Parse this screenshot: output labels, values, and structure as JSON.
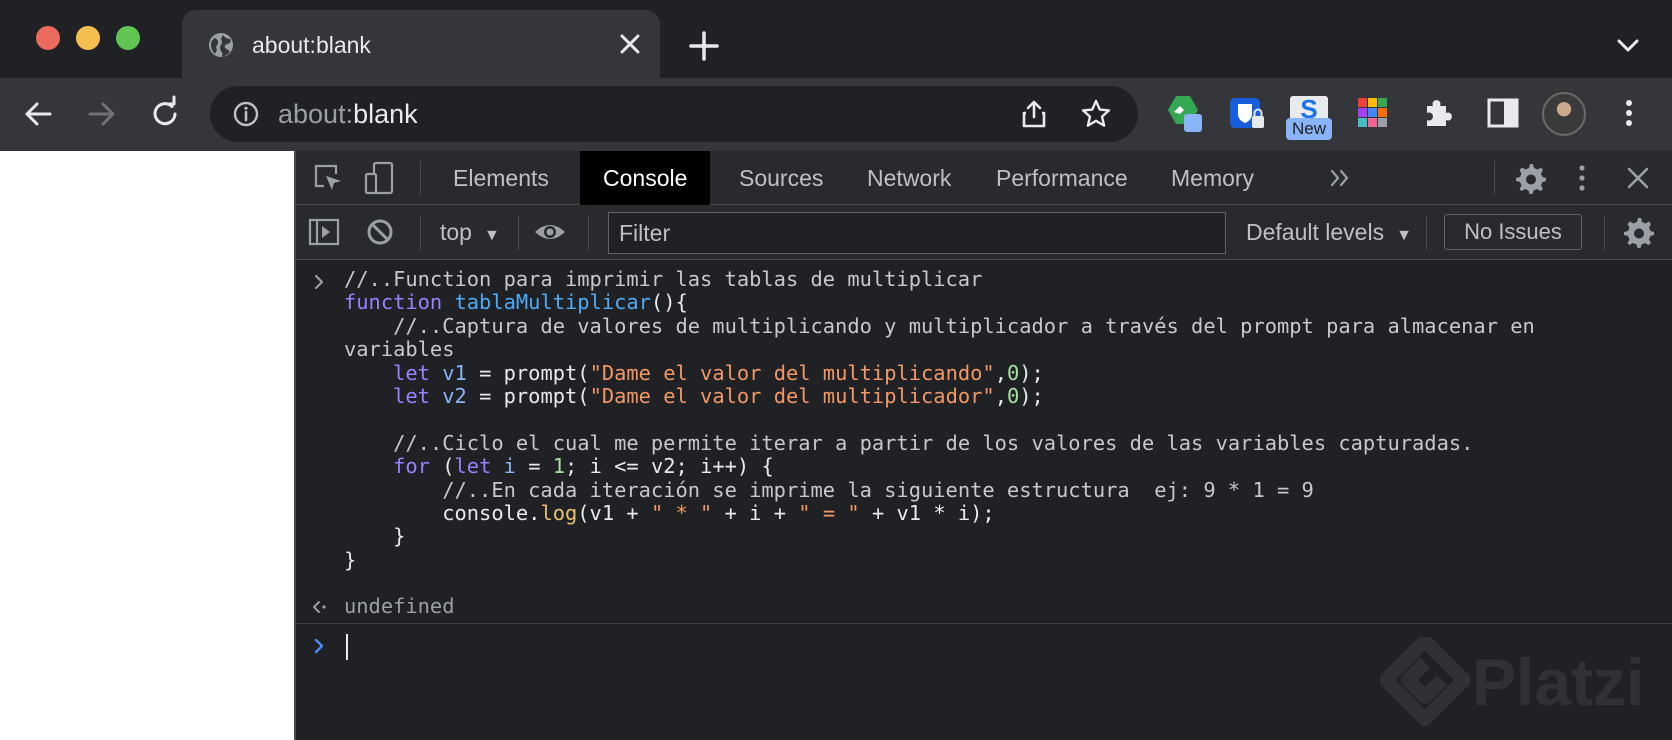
{
  "tab": {
    "title": "about:blank",
    "icon": "globe-icon"
  },
  "address_bar": {
    "scheme": "about:",
    "host": "blank"
  },
  "extensions": {
    "new_badge": "New"
  },
  "devtools": {
    "tabs": [
      "Elements",
      "Console",
      "Sources",
      "Network",
      "Performance",
      "Memory"
    ],
    "active_tab": "Console",
    "context": "top",
    "filter_placeholder": "Filter",
    "levels": "Default levels",
    "issues": "No Issues"
  },
  "console": {
    "code_lines": [
      "//..Function para imprimir las tablas de multiplicar",
      "function tablaMultiplicar(){",
      "    //..Captura de valores de multiplicando y multiplicador a través del prompt para almacenar en variables",
      "    let v1 = prompt(\"Dame el valor del multiplicando\",0);",
      "    let v2 = prompt(\"Dame el valor del multiplicador\",0);",
      "",
      "    //..Ciclo el cual me permite iterar a partir de los valores de las variables capturadas.",
      "    for (let i = 1; i <= v2; i++) {",
      "        //..En cada iteración se imprime la siguiente estructura  ej: 9 * 1 = 9",
      "        console.log(v1 + \" * \" + i + \" = \" + v1 * i);",
      "    }",
      "}"
    ],
    "result": "undefined"
  },
  "watermark": {
    "text": "Platzi"
  },
  "colors": {
    "chrome_dark": "#202124",
    "toolbar": "#35363a",
    "devtools_bar": "#292a2d",
    "active_tab_bg": "#000000",
    "keyword": "#9980ff",
    "string": "#f29766",
    "number": "#a8e2a1",
    "function_name": "#4dabf7"
  }
}
